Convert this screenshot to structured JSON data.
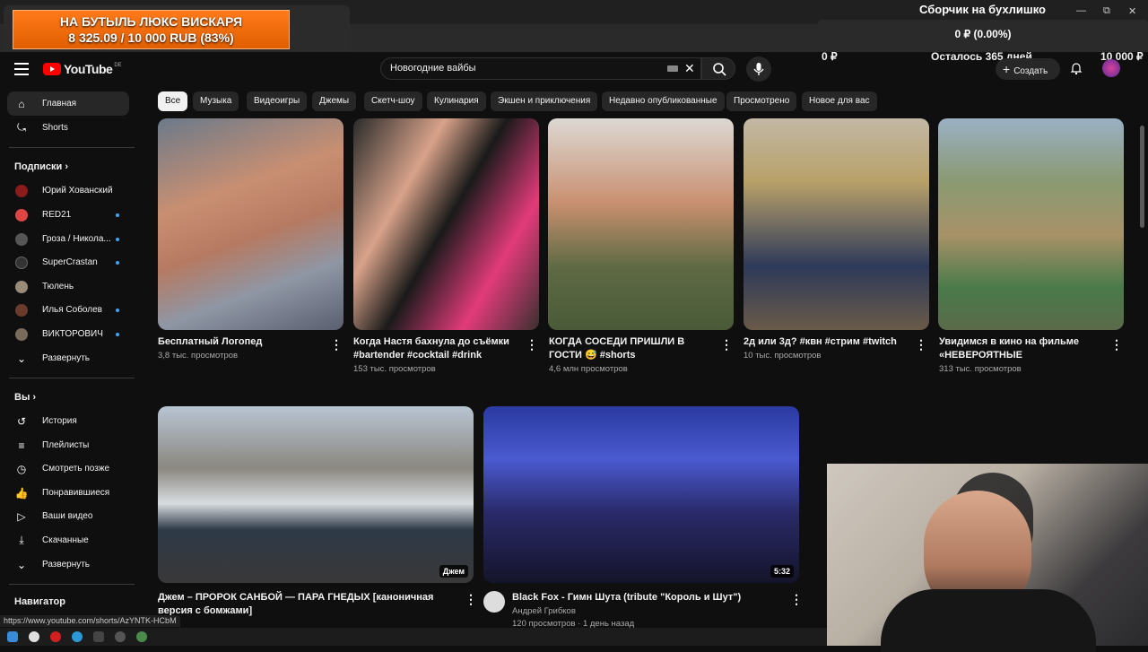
{
  "overlay": {
    "donation_line1": "НА БУТЫЛЬ ЛЮКС ВИСКАРЯ",
    "donation_line2": "8 325.09 / 10 000 RUB (83%)",
    "donation_progress": 0.83,
    "goal_title": "Сборчик на бухлишко",
    "goal_value": "0 ₽ (0.00%)",
    "goal_progress": 0.0,
    "goal_left": "0 ₽",
    "goal_remaining": "Осталось 365 дней",
    "goal_right": "10 000 ₽"
  },
  "header": {
    "logo_text": "YouTube",
    "logo_region": "DE",
    "search_value": "Новогодние вайбы",
    "create_label": "Создать"
  },
  "sidebar": {
    "home": "Главная",
    "shorts": "Shorts",
    "subscriptions_title": "Подписки",
    "subscriptions": [
      {
        "label": "Юрий Хованский",
        "new": false,
        "color": "#8a1c1c"
      },
      {
        "label": "RED21",
        "new": true,
        "color": "#e04545"
      },
      {
        "label": "Гроза / Никола...",
        "new": true,
        "color": "#555"
      },
      {
        "label": "SuperCrastan",
        "new": true,
        "color": "#333"
      },
      {
        "label": "Тюлень",
        "new": false,
        "color": "#9a8a7a"
      },
      {
        "label": "Илья Соболев",
        "new": true,
        "color": "#6a3a2a"
      },
      {
        "label": "ВИКТОРОВИЧ",
        "new": true,
        "color": "#7a6a5a"
      }
    ],
    "expand_subs": "Развернуть",
    "you_title": "Вы",
    "you_items": [
      {
        "label": "История",
        "icon": "history-icon"
      },
      {
        "label": "Плейлисты",
        "icon": "playlists-icon"
      },
      {
        "label": "Смотреть позже",
        "icon": "watch-later-icon"
      },
      {
        "label": "Понравившиеся",
        "icon": "like-icon"
      },
      {
        "label": "Ваши видео",
        "icon": "your-videos-icon"
      },
      {
        "label": "Скачанные",
        "icon": "download-icon"
      }
    ],
    "expand_you": "Развернуть",
    "navigator_title": "Навигатор"
  },
  "chips": [
    "Все",
    "Музыка",
    "Видеоигры",
    "Джемы",
    "Скетч-шоу",
    "Кулинария",
    "Экшен и приключения",
    "Недавно опубликованные",
    "Просмотрено",
    "Новое для вас"
  ],
  "shorts": [
    {
      "title": "Бесплатный Логопед",
      "views": "3,8 тыс. просмотров"
    },
    {
      "title": "Когда Настя бахнула до съёмки #bartender #cocktail #drink",
      "views": "153 тыс. просмотров"
    },
    {
      "title": "КОГДА СОСЕДИ ПРИШЛИ В ГОСТИ 😅 #shorts",
      "views": "4,6 млн просмотров"
    },
    {
      "title": "2д или 3д? #квн #стрим #twitch",
      "views": "10 тыс. просмотров"
    },
    {
      "title": "Увидимся в кино на фильме «НЕВЕРОЯТНЫЕ ПРИКЛЮЧЕНИЯ ...",
      "views": "313 тыс. просмотров"
    }
  ],
  "videos": [
    {
      "title": "Джем – ПРОРОК САНБОЙ — ПАРА ГНЕДЫХ [каноничная версия с бомжами]",
      "badge": "Джем",
      "channel": "",
      "meta": ""
    },
    {
      "title": "Black Fox - Гимн Шута (tribute \"Король и Шут\")",
      "badge": "5:32",
      "channel": "Андрей Грибков",
      "meta": "120 просмотров · 1 день назад"
    }
  ],
  "status_url": "https://www.youtube.com/shorts/AzYNTK-HCbM"
}
